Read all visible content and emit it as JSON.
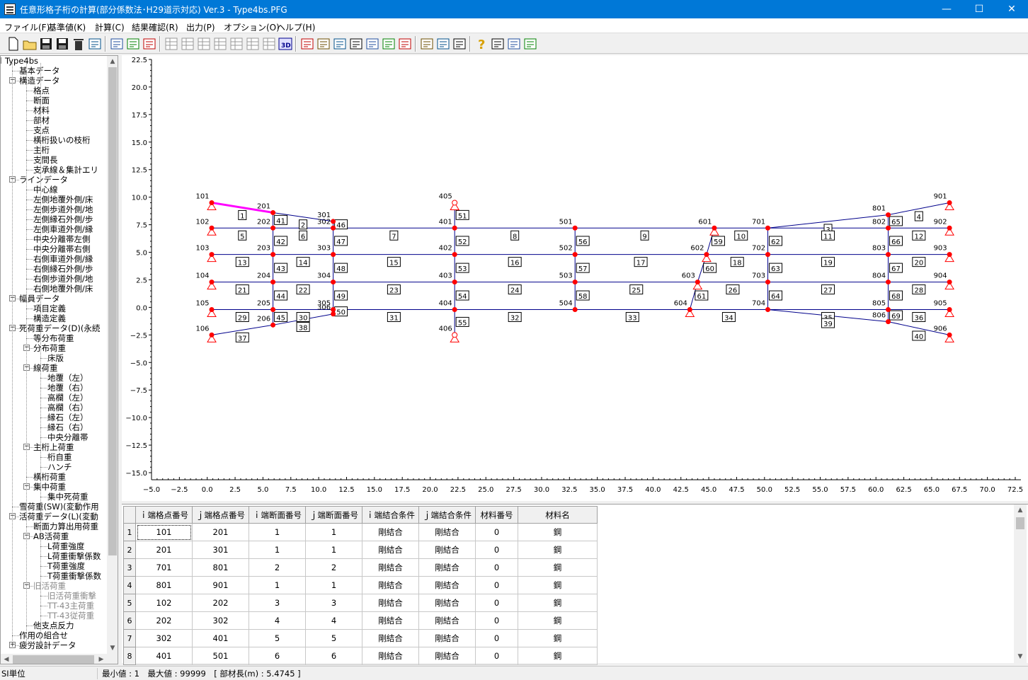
{
  "window": {
    "title": "任意形格子桁の計算(部分係数法･H29道示対応) Ver.3 - Type4bs.PFG",
    "minimize": "—",
    "maximize": "☐",
    "close": "✕"
  },
  "menu": [
    "ファイル(F)",
    "基準値(K)",
    "計算(C)",
    "結果確認(R)",
    "出力(P)",
    "オプション(O)",
    "ヘルプ(H)"
  ],
  "toolbar": {
    "groups": [
      [
        "new-file-icon",
        "open-folder-icon",
        "save-icon",
        "save-as-icon",
        "delete-icon",
        "export-icon"
      ],
      [
        "edit-node-icon",
        "split-member-icon",
        "table-icon"
      ],
      [
        "view-1-icon",
        "view-2-icon",
        "view-3-icon",
        "view-4-icon",
        "view-5-icon",
        "view-6-icon",
        "view-7-icon",
        "view-3d-icon"
      ],
      [
        "result-1-icon",
        "result-2-icon",
        "result-3-icon",
        "result-4-icon",
        "result-5-icon",
        "result-6-icon",
        "result-7-icon"
      ],
      [
        "check-icon",
        "calculate-icon",
        "report-icon"
      ],
      [
        "help-icon",
        "manual-icon",
        "info-icon",
        "settings-grid-icon"
      ]
    ]
  },
  "tree": [
    {
      "label": "Type4bs",
      "level": 0,
      "exp": "-"
    },
    {
      "label": "基本データ",
      "level": 1
    },
    {
      "label": "構造データ",
      "level": 1,
      "exp": "-"
    },
    {
      "label": "格点",
      "level": 2
    },
    {
      "label": "断面",
      "level": 2
    },
    {
      "label": "材料",
      "level": 2
    },
    {
      "label": "部材",
      "level": 2
    },
    {
      "label": "支点",
      "level": 2
    },
    {
      "label": "横桁扱いの枝桁",
      "level": 2
    },
    {
      "label": "主桁",
      "level": 2
    },
    {
      "label": "支間長",
      "level": 2
    },
    {
      "label": "支承線＆集計エリ",
      "level": 2
    },
    {
      "label": "ラインデータ",
      "level": 1,
      "exp": "-"
    },
    {
      "label": "中心線",
      "level": 2
    },
    {
      "label": "左側地覆外側/床",
      "level": 2
    },
    {
      "label": "左側歩道外側/地",
      "level": 2
    },
    {
      "label": "左側縁石外側/歩",
      "level": 2
    },
    {
      "label": "左側車道外側/縁",
      "level": 2
    },
    {
      "label": "中央分離帯左側",
      "level": 2
    },
    {
      "label": "中央分離帯右側",
      "level": 2
    },
    {
      "label": "右側車道外側/縁",
      "level": 2
    },
    {
      "label": "右側縁石外側/歩",
      "level": 2
    },
    {
      "label": "右側歩道外側/地",
      "level": 2
    },
    {
      "label": "右側地覆外側/床",
      "level": 2
    },
    {
      "label": "幅員データ",
      "level": 1,
      "exp": "-"
    },
    {
      "label": "項目定義",
      "level": 2
    },
    {
      "label": "構造定義",
      "level": 2
    },
    {
      "label": "死荷重データ(D)(永続",
      "level": 1,
      "exp": "-"
    },
    {
      "label": "等分布荷重",
      "level": 2
    },
    {
      "label": "分布荷重",
      "level": 2,
      "exp": "-"
    },
    {
      "label": "床版",
      "level": 3
    },
    {
      "label": "線荷重",
      "level": 2,
      "exp": "-"
    },
    {
      "label": "地覆（左）",
      "level": 3
    },
    {
      "label": "地覆（右）",
      "level": 3
    },
    {
      "label": "高欄（左）",
      "level": 3
    },
    {
      "label": "高欄（右）",
      "level": 3
    },
    {
      "label": "縁石（左）",
      "level": 3
    },
    {
      "label": "縁石（右）",
      "level": 3
    },
    {
      "label": "中央分離帯",
      "level": 3
    },
    {
      "label": "主桁上荷重",
      "level": 2,
      "exp": "-"
    },
    {
      "label": "桁自重",
      "level": 3
    },
    {
      "label": "ハンチ",
      "level": 3
    },
    {
      "label": "横桁荷重",
      "level": 2
    },
    {
      "label": "集中荷重",
      "level": 2,
      "exp": "-"
    },
    {
      "label": "集中死荷重",
      "level": 3
    },
    {
      "label": "雪荷重(SW)(変動作用",
      "level": 1
    },
    {
      "label": "活荷重データ(L)(変動",
      "level": 1,
      "exp": "-"
    },
    {
      "label": "断面力算出用荷重",
      "level": 2
    },
    {
      "label": "AB活荷重",
      "level": 2,
      "exp": "-"
    },
    {
      "label": "L荷重強度",
      "level": 3
    },
    {
      "label": "L荷重衝撃係数",
      "level": 3
    },
    {
      "label": "T荷重強度",
      "level": 3
    },
    {
      "label": "T荷重衝撃係数",
      "level": 3
    },
    {
      "label": "旧活荷重",
      "level": 2,
      "exp": "-",
      "dis": true
    },
    {
      "label": "旧活荷重衝撃",
      "level": 3,
      "dis": true
    },
    {
      "label": "TT-43主荷重",
      "level": 3,
      "dis": true
    },
    {
      "label": "TT-43従荷重",
      "level": 3,
      "dis": true
    },
    {
      "label": "他支点反力",
      "level": 2
    },
    {
      "label": "作用の組合せ",
      "level": 1
    },
    {
      "label": "疲労設計データ",
      "level": 1,
      "exp": "+"
    }
  ],
  "chart_data": {
    "type": "scatter",
    "title": "",
    "xlabel": "",
    "ylabel": "",
    "xlim": [
      -5.0,
      72.5
    ],
    "ylim": [
      -15.0,
      22.5
    ],
    "x_ticks": [
      "−5.0",
      "−2.5",
      "0.0",
      "2.5",
      "5.0",
      "7.5",
      "10.0",
      "12.5",
      "15.0",
      "17.5",
      "20.0",
      "22.5",
      "25.0",
      "27.5",
      "30.0",
      "32.5",
      "35.0",
      "37.5",
      "40.0",
      "42.5",
      "45.0",
      "47.5",
      "50.0",
      "52.5",
      "55.0",
      "57.5",
      "60.0",
      "62.5",
      "65.0",
      "67.5",
      "70.0",
      "72.5"
    ],
    "y_ticks": [
      "22.5",
      "20.0",
      "17.5",
      "15.0",
      "12.5",
      "10.0",
      "7.5",
      "5.0",
      "2.5",
      "0.0",
      "−2.5",
      "−5.0",
      "−7.5",
      "−10.0",
      "−12.5",
      "−15.0"
    ],
    "nodes": [
      {
        "id": "101",
        "x": 0.4,
        "y": 9.5,
        "support": true
      },
      {
        "id": "102",
        "x": 0.4,
        "y": 7.2,
        "support": true
      },
      {
        "id": "103",
        "x": 0.4,
        "y": 4.8,
        "support": true
      },
      {
        "id": "104",
        "x": 0.4,
        "y": 2.3,
        "support": true
      },
      {
        "id": "105",
        "x": 0.4,
        "y": -0.2,
        "support": true
      },
      {
        "id": "106",
        "x": 0.4,
        "y": -2.5,
        "support": true
      },
      {
        "id": "201",
        "x": 5.9,
        "y": 8.6
      },
      {
        "id": "202",
        "x": 5.9,
        "y": 7.2
      },
      {
        "id": "203",
        "x": 5.9,
        "y": 4.8
      },
      {
        "id": "204",
        "x": 5.9,
        "y": 2.3
      },
      {
        "id": "205",
        "x": 5.9,
        "y": -0.2
      },
      {
        "id": "206",
        "x": 5.9,
        "y": -1.6
      },
      {
        "id": "301",
        "x": 11.3,
        "y": 7.8
      },
      {
        "id": "302",
        "x": 11.3,
        "y": 7.2
      },
      {
        "id": "303",
        "x": 11.3,
        "y": 4.8
      },
      {
        "id": "304",
        "x": 11.3,
        "y": 2.3
      },
      {
        "id": "305",
        "x": 11.3,
        "y": -0.2
      },
      {
        "id": "306",
        "x": 11.3,
        "y": -0.6
      },
      {
        "id": "401",
        "x": 22.2,
        "y": 7.2
      },
      {
        "id": "402",
        "x": 22.2,
        "y": 4.8
      },
      {
        "id": "403",
        "x": 22.2,
        "y": 2.3
      },
      {
        "id": "404",
        "x": 22.2,
        "y": -0.2
      },
      {
        "id": "405",
        "x": 22.2,
        "y": 9.5,
        "support": true,
        "hollow": true
      },
      {
        "id": "406",
        "x": 22.2,
        "y": -2.5,
        "support": true,
        "hollow": true
      },
      {
        "id": "501",
        "x": 33.0,
        "y": 7.2
      },
      {
        "id": "502",
        "x": 33.0,
        "y": 4.8
      },
      {
        "id": "503",
        "x": 33.0,
        "y": 2.3
      },
      {
        "id": "504",
        "x": 33.0,
        "y": -0.2
      },
      {
        "id": "601",
        "x": 45.5,
        "y": 7.2,
        "support": true
      },
      {
        "id": "602",
        "x": 44.8,
        "y": 4.8,
        "support": true
      },
      {
        "id": "603",
        "x": 44.0,
        "y": 2.3,
        "support": true
      },
      {
        "id": "604",
        "x": 43.3,
        "y": -0.2,
        "support": true
      },
      {
        "id": "701",
        "x": 50.3,
        "y": 7.2
      },
      {
        "id": "702",
        "x": 50.3,
        "y": 4.8
      },
      {
        "id": "703",
        "x": 50.3,
        "y": 2.3
      },
      {
        "id": "704",
        "x": 50.3,
        "y": -0.2
      },
      {
        "id": "801",
        "x": 61.1,
        "y": 8.4
      },
      {
        "id": "802",
        "x": 61.1,
        "y": 7.2
      },
      {
        "id": "803",
        "x": 61.1,
        "y": 4.8
      },
      {
        "id": "804",
        "x": 61.1,
        "y": 2.3
      },
      {
        "id": "805",
        "x": 61.1,
        "y": -0.2
      },
      {
        "id": "806",
        "x": 61.1,
        "y": -1.3
      },
      {
        "id": "901",
        "x": 66.6,
        "y": 9.5,
        "support": true
      },
      {
        "id": "902",
        "x": 66.6,
        "y": 7.2,
        "support": true
      },
      {
        "id": "903",
        "x": 66.6,
        "y": 4.8,
        "support": true
      },
      {
        "id": "904",
        "x": 66.6,
        "y": 2.3,
        "support": true
      },
      {
        "id": "905",
        "x": 66.6,
        "y": -0.2,
        "support": true
      },
      {
        "id": "906",
        "x": 66.6,
        "y": -2.5,
        "support": true
      }
    ],
    "members": [
      {
        "no": "1",
        "i": "101",
        "j": "201",
        "sel": true
      },
      {
        "no": "2",
        "i": "201",
        "j": "301"
      },
      {
        "no": "3",
        "i": "701",
        "j": "801"
      },
      {
        "no": "4",
        "i": "801",
        "j": "901"
      },
      {
        "no": "5",
        "i": "102",
        "j": "202"
      },
      {
        "no": "6",
        "i": "202",
        "j": "302"
      },
      {
        "no": "7",
        "i": "302",
        "j": "401"
      },
      {
        "no": "8",
        "i": "401",
        "j": "501"
      },
      {
        "no": "9",
        "i": "501",
        "j": "601"
      },
      {
        "no": "10",
        "i": "601",
        "j": "701"
      },
      {
        "no": "11",
        "i": "701",
        "j": "802"
      },
      {
        "no": "12",
        "i": "802",
        "j": "902"
      },
      {
        "no": "13",
        "i": "103",
        "j": "203"
      },
      {
        "no": "14",
        "i": "203",
        "j": "303"
      },
      {
        "no": "15",
        "i": "303",
        "j": "402"
      },
      {
        "no": "16",
        "i": "402",
        "j": "502"
      },
      {
        "no": "17",
        "i": "502",
        "j": "602"
      },
      {
        "no": "18",
        "i": "602",
        "j": "702"
      },
      {
        "no": "19",
        "i": "702",
        "j": "803"
      },
      {
        "no": "20",
        "i": "803",
        "j": "903"
      },
      {
        "no": "21",
        "i": "104",
        "j": "204"
      },
      {
        "no": "22",
        "i": "204",
        "j": "304"
      },
      {
        "no": "23",
        "i": "304",
        "j": "403"
      },
      {
        "no": "24",
        "i": "403",
        "j": "503"
      },
      {
        "no": "25",
        "i": "503",
        "j": "603"
      },
      {
        "no": "26",
        "i": "603",
        "j": "703"
      },
      {
        "no": "27",
        "i": "703",
        "j": "804"
      },
      {
        "no": "28",
        "i": "804",
        "j": "904"
      },
      {
        "no": "29",
        "i": "105",
        "j": "205"
      },
      {
        "no": "30",
        "i": "205",
        "j": "305"
      },
      {
        "no": "31",
        "i": "305",
        "j": "404"
      },
      {
        "no": "32",
        "i": "404",
        "j": "504"
      },
      {
        "no": "33",
        "i": "504",
        "j": "604"
      },
      {
        "no": "34",
        "i": "604",
        "j": "704"
      },
      {
        "no": "35",
        "i": "704",
        "j": "805"
      },
      {
        "no": "36",
        "i": "805",
        "j": "905"
      },
      {
        "no": "37",
        "i": "106",
        "j": "206"
      },
      {
        "no": "38",
        "i": "206",
        "j": "306"
      },
      {
        "no": "39",
        "i": "704",
        "j": "806"
      },
      {
        "no": "40",
        "i": "806",
        "j": "906"
      },
      {
        "no": "41",
        "i": "201",
        "j": "202"
      },
      {
        "no": "42",
        "i": "202",
        "j": "203"
      },
      {
        "no": "43",
        "i": "203",
        "j": "204"
      },
      {
        "no": "44",
        "i": "204",
        "j": "205"
      },
      {
        "no": "45",
        "i": "205",
        "j": "206"
      },
      {
        "no": "46",
        "i": "301",
        "j": "302"
      },
      {
        "no": "47",
        "i": "302",
        "j": "303"
      },
      {
        "no": "48",
        "i": "303",
        "j": "304"
      },
      {
        "no": "49",
        "i": "304",
        "j": "305"
      },
      {
        "no": "50",
        "i": "305",
        "j": "306"
      },
      {
        "no": "51",
        "i": "405",
        "j": "401"
      },
      {
        "no": "52",
        "i": "401",
        "j": "402"
      },
      {
        "no": "53",
        "i": "402",
        "j": "403"
      },
      {
        "no": "54",
        "i": "403",
        "j": "404"
      },
      {
        "no": "55",
        "i": "404",
        "j": "406"
      },
      {
        "no": "56",
        "i": "501",
        "j": "502"
      },
      {
        "no": "57",
        "i": "502",
        "j": "503"
      },
      {
        "no": "58",
        "i": "503",
        "j": "504"
      },
      {
        "no": "59",
        "i": "601",
        "j": "602"
      },
      {
        "no": "60",
        "i": "602",
        "j": "603"
      },
      {
        "no": "61",
        "i": "603",
        "j": "604"
      },
      {
        "no": "62",
        "i": "701",
        "j": "702"
      },
      {
        "no": "63",
        "i": "702",
        "j": "703"
      },
      {
        "no": "64",
        "i": "703",
        "j": "704"
      },
      {
        "no": "65",
        "i": "801",
        "j": "802"
      },
      {
        "no": "66",
        "i": "802",
        "j": "803"
      },
      {
        "no": "67",
        "i": "803",
        "j": "804"
      },
      {
        "no": "68",
        "i": "804",
        "j": "805"
      },
      {
        "no": "69",
        "i": "805",
        "j": "806"
      }
    ]
  },
  "grid": {
    "headers": [
      "ｉ端格点番号",
      "ｊ端格点番号",
      "ｉ端断面番号",
      "ｊ端断面番号",
      "ｉ端結合条件",
      "ｊ端結合条件",
      "材料番号",
      "材料名"
    ],
    "rows": [
      [
        "1",
        "101",
        "201",
        "1",
        "1",
        "剛結合",
        "剛結合",
        "0",
        "鋼"
      ],
      [
        "2",
        "201",
        "301",
        "1",
        "1",
        "剛結合",
        "剛結合",
        "0",
        "鋼"
      ],
      [
        "3",
        "701",
        "801",
        "2",
        "2",
        "剛結合",
        "剛結合",
        "0",
        "鋼"
      ],
      [
        "4",
        "801",
        "901",
        "1",
        "1",
        "剛結合",
        "剛結合",
        "0",
        "鋼"
      ],
      [
        "5",
        "102",
        "202",
        "3",
        "3",
        "剛結合",
        "剛結合",
        "0",
        "鋼"
      ],
      [
        "6",
        "202",
        "302",
        "4",
        "4",
        "剛結合",
        "剛結合",
        "0",
        "鋼"
      ],
      [
        "7",
        "302",
        "401",
        "5",
        "5",
        "剛結合",
        "剛結合",
        "0",
        "鋼"
      ],
      [
        "8",
        "401",
        "501",
        "6",
        "6",
        "剛結合",
        "剛結合",
        "0",
        "鋼"
      ]
    ]
  },
  "status": {
    "unit": "SI単位",
    "info": "最小値 : 1　最大値 : 99999　[ 部材長(m) : 5.4745 ]"
  },
  "colors": {
    "accent": "#0078d7",
    "member": "#00008b",
    "selected": "#ff00ff",
    "node": "#ff0000",
    "support": "#ff0000"
  }
}
